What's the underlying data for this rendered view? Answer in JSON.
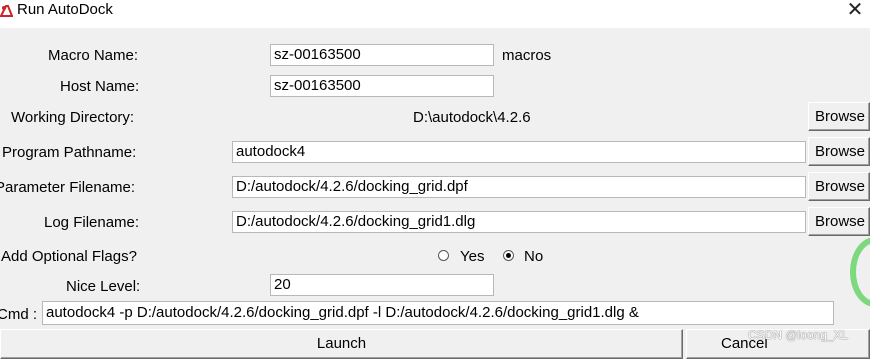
{
  "window": {
    "title": "Run AutoDock"
  },
  "form": {
    "macro_name_label": "Macro Name:",
    "macro_name_value": "sz-00163500",
    "macros_label": "macros",
    "host_name_label": "Host Name:",
    "host_name_value": "sz-00163500",
    "working_dir_label": "Working Directory:",
    "working_dir_value": "D:\\autodock\\4.2.6",
    "program_label": "Program Pathname:",
    "program_value": "autodock4",
    "parameter_label": "Parameter Filename:",
    "parameter_value": "D:/autodock/4.2.6/docking_grid.dpf",
    "log_label": "Log Filename:",
    "log_value": "D:/autodock/4.2.6/docking_grid1.dlg",
    "flags_label": "Add Optional Flags?",
    "flags_yes": "Yes",
    "flags_no": "No",
    "flags_selected": "No",
    "nice_label": "Nice Level:",
    "nice_value": "20",
    "cmd_label": "Cmd :",
    "cmd_value": "autodock4  -p D:/autodock/4.2.6/docking_grid.dpf -l D:/autodock/4.2.6/docking_grid1.dlg &",
    "browse_label": "Browse"
  },
  "buttons": {
    "launch": "Launch",
    "cancel": "Cancel"
  },
  "watermark": "CSDN @loong_XL",
  "colors": {
    "accent_ring": "#7ed87e",
    "icon": "#d0202a"
  },
  "icons": {
    "app": "autodock-icon",
    "close": "close-icon"
  }
}
